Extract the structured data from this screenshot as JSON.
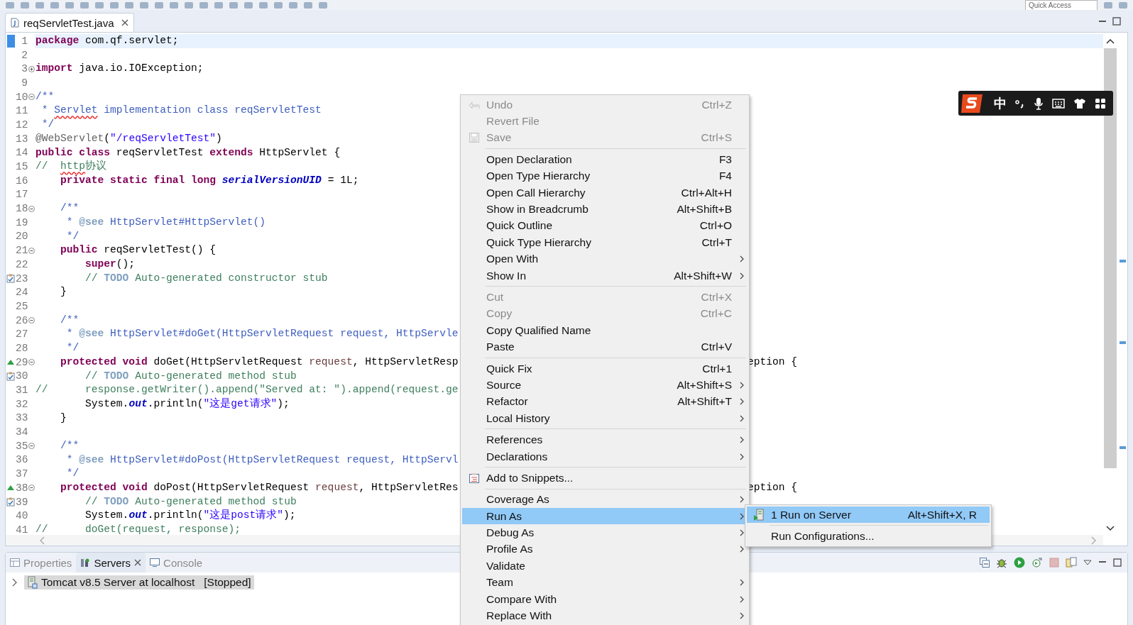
{
  "toolbar": {
    "quick_access": {
      "placeholder": "Quick Access"
    }
  },
  "editor": {
    "tabs": [
      {
        "title": "reqServletTest.java",
        "selected": true
      }
    ],
    "lines": [
      {
        "number": "1",
        "kind": "bookmark",
        "current": true,
        "tokens": [
          {
            "kind": "keyword",
            "text": "package"
          },
          {
            "kind": "plain",
            "text": " com.qf.servlet;"
          }
        ]
      },
      {
        "number": "2",
        "kind": "code",
        "current": false
      },
      {
        "number": "3",
        "kind": "code",
        "current": false,
        "collapsed": true,
        "tokens": [
          {
            "kind": "keyword",
            "text": "import"
          },
          {
            "kind": "plain",
            "text": " java.io.IOException;"
          }
        ]
      },
      {
        "number": "9",
        "kind": "code",
        "current": false
      },
      {
        "number": "10",
        "kind": "code",
        "current": false,
        "collapsed": false,
        "tokens": [
          {
            "kind": "javadoc",
            "text": "/**"
          }
        ]
      },
      {
        "number": "11",
        "kind": "code",
        "current": false,
        "tokens": [
          {
            "kind": "javadoc",
            "text": " * "
          },
          {
            "kind": "misspelled-javadoc",
            "text": "Servlet"
          },
          {
            "kind": "javadoc",
            "text": " implementation class reqServletTest"
          }
        ]
      },
      {
        "number": "12",
        "kind": "code",
        "current": false,
        "tokens": [
          {
            "kind": "javadoc",
            "text": " */"
          }
        ]
      },
      {
        "number": "13",
        "kind": "code",
        "current": false,
        "tokens": [
          {
            "kind": "annotation",
            "text": "@WebServlet"
          },
          {
            "kind": "plain",
            "text": "("
          },
          {
            "kind": "string",
            "text": "\"/reqServletTest\""
          },
          {
            "kind": "plain",
            "text": ")"
          }
        ]
      },
      {
        "number": "14",
        "kind": "code",
        "current": false,
        "tokens": [
          {
            "kind": "keyword",
            "text": "public class"
          },
          {
            "kind": "plain",
            "text": " reqServletTest "
          },
          {
            "kind": "keyword",
            "text": "extends"
          },
          {
            "kind": "plain",
            "text": " HttpServlet {"
          }
        ]
      },
      {
        "number": "15",
        "kind": "code",
        "current": false,
        "tokens": [
          {
            "kind": "comment",
            "text": "//  "
          },
          {
            "kind": "misspelled-comment",
            "text": "http"
          },
          {
            "kind": "comment",
            "text": "协议"
          }
        ]
      },
      {
        "number": "16",
        "kind": "code",
        "current": false,
        "tokens": [
          {
            "kind": "keyword",
            "text": "    private static final long"
          },
          {
            "kind": "static-field",
            "text": " serialVersionUID"
          },
          {
            "kind": "plain",
            "text": " = 1L;"
          }
        ]
      },
      {
        "number": "17",
        "kind": "code",
        "current": false
      },
      {
        "number": "18",
        "kind": "code",
        "current": false,
        "collapsed": false,
        "tokens": [
          {
            "kind": "javadoc",
            "text": "    /**"
          }
        ]
      },
      {
        "number": "19",
        "kind": "code",
        "current": false,
        "tokens": [
          {
            "kind": "javadoc",
            "text": "     * "
          },
          {
            "kind": "tag",
            "text": "@see"
          },
          {
            "kind": "javadoc",
            "text": " HttpServlet#HttpServlet()"
          }
        ]
      },
      {
        "number": "20",
        "kind": "code",
        "current": false,
        "tokens": [
          {
            "kind": "javadoc",
            "text": "     */"
          }
        ]
      },
      {
        "number": "21",
        "kind": "code",
        "current": false,
        "collapsed": false,
        "tokens": [
          {
            "kind": "keyword",
            "text": "    public"
          },
          {
            "kind": "plain",
            "text": " reqServletTest() {"
          }
        ]
      },
      {
        "number": "22",
        "kind": "code",
        "current": false,
        "tokens": [
          {
            "kind": "keyword",
            "text": "        super"
          },
          {
            "kind": "plain",
            "text": "();"
          }
        ]
      },
      {
        "number": "23",
        "kind": "task",
        "current": false,
        "tokens": [
          {
            "kind": "comment",
            "text": "        // "
          },
          {
            "kind": "todo",
            "text": "TODO"
          },
          {
            "kind": "comment",
            "text": " Auto-generated constructor stub"
          }
        ]
      },
      {
        "number": "24",
        "kind": "code",
        "current": false,
        "tokens": [
          {
            "kind": "plain",
            "text": "    }"
          }
        ]
      },
      {
        "number": "25",
        "kind": "code",
        "current": false
      },
      {
        "number": "26",
        "kind": "code",
        "current": false,
        "collapsed": false,
        "tokens": [
          {
            "kind": "javadoc",
            "text": "    /**"
          }
        ]
      },
      {
        "number": "27",
        "kind": "code",
        "current": false,
        "tokens": [
          {
            "kind": "javadoc",
            "text": "     * "
          },
          {
            "kind": "tag",
            "text": "@see"
          },
          {
            "kind": "javadoc",
            "text": " HttpServlet#doGet(HttpServletRequest request, HttpServle"
          }
        ]
      },
      {
        "number": "28",
        "kind": "code",
        "current": false,
        "tokens": [
          {
            "kind": "javadoc",
            "text": "     */"
          }
        ]
      },
      {
        "number": "29",
        "kind": "override",
        "current": false,
        "collapsed": false,
        "tokens": [
          {
            "kind": "keyword",
            "text": "    protected void"
          },
          {
            "kind": "plain",
            "text": " doGet(HttpServletRequest "
          },
          {
            "kind": "param",
            "text": "request"
          },
          {
            "kind": "plain",
            "text": ", HttpServletResp"
          }
        ],
        "tail": "eption {"
      },
      {
        "number": "30",
        "kind": "task",
        "current": false,
        "tokens": [
          {
            "kind": "comment",
            "text": "        // "
          },
          {
            "kind": "todo",
            "text": "TODO"
          },
          {
            "kind": "comment",
            "text": " Auto-generated method stub"
          }
        ]
      },
      {
        "number": "31",
        "kind": "code",
        "current": false,
        "tokens": [
          {
            "kind": "comment",
            "text": "//      response.getWriter().append(\"Served at: \").append(request.ge"
          }
        ]
      },
      {
        "number": "32",
        "kind": "code",
        "current": false,
        "tokens": [
          {
            "kind": "plain",
            "text": "        System."
          },
          {
            "kind": "static-field",
            "text": "out"
          },
          {
            "kind": "plain",
            "text": ".println("
          },
          {
            "kind": "string",
            "text": "\"这是get请求\""
          },
          {
            "kind": "plain",
            "text": ");"
          }
        ]
      },
      {
        "number": "33",
        "kind": "code",
        "current": false,
        "tokens": [
          {
            "kind": "plain",
            "text": "    }"
          }
        ]
      },
      {
        "number": "34",
        "kind": "code",
        "current": false
      },
      {
        "number": "35",
        "kind": "code",
        "current": false,
        "collapsed": false,
        "tokens": [
          {
            "kind": "javadoc",
            "text": "    /**"
          }
        ]
      },
      {
        "number": "36",
        "kind": "code",
        "current": false,
        "tokens": [
          {
            "kind": "javadoc",
            "text": "     * "
          },
          {
            "kind": "tag",
            "text": "@see"
          },
          {
            "kind": "javadoc",
            "text": " HttpServlet#doPost(HttpServletRequest request, HttpServl"
          }
        ]
      },
      {
        "number": "37",
        "kind": "code",
        "current": false,
        "tokens": [
          {
            "kind": "javadoc",
            "text": "     */"
          }
        ]
      },
      {
        "number": "38",
        "kind": "override",
        "current": false,
        "collapsed": false,
        "tokens": [
          {
            "kind": "keyword",
            "text": "    protected void"
          },
          {
            "kind": "plain",
            "text": " doPost(HttpServletRequest "
          },
          {
            "kind": "param",
            "text": "request"
          },
          {
            "kind": "plain",
            "text": ", HttpServletRes"
          }
        ],
        "tail": "eption {"
      },
      {
        "number": "39",
        "kind": "task",
        "current": false,
        "tokens": [
          {
            "kind": "comment",
            "text": "        // "
          },
          {
            "kind": "todo",
            "text": "TODO"
          },
          {
            "kind": "comment",
            "text": " Auto-generated method stub"
          }
        ]
      },
      {
        "number": "40",
        "kind": "code",
        "current": false,
        "tokens": [
          {
            "kind": "plain",
            "text": "        System."
          },
          {
            "kind": "static-field",
            "text": "out"
          },
          {
            "kind": "plain",
            "text": ".println("
          },
          {
            "kind": "string",
            "text": "\"这是post请求\""
          },
          {
            "kind": "plain",
            "text": ");"
          }
        ]
      },
      {
        "number": "41",
        "kind": "code",
        "current": false,
        "tokens": [
          {
            "kind": "comment",
            "text": "//      doGet(request, response);"
          }
        ]
      }
    ]
  },
  "context_menu": {
    "items": [
      {
        "kind": "undo",
        "label": "Undo",
        "shortcut": "Ctrl+Z",
        "disabled": true,
        "submenu": false,
        "selected": false
      },
      {
        "kind": "item",
        "label": "Revert File",
        "disabled": true,
        "submenu": false,
        "selected": false
      },
      {
        "kind": "save",
        "label": "Save",
        "shortcut": "Ctrl+S",
        "disabled": true,
        "submenu": false,
        "selected": false
      },
      {
        "kind": "separator"
      },
      {
        "kind": "item",
        "label": "Open Declaration",
        "shortcut": "F3",
        "disabled": false,
        "submenu": false,
        "selected": false
      },
      {
        "kind": "item",
        "label": "Open Type Hierarchy",
        "shortcut": "F4",
        "disabled": false,
        "submenu": false,
        "selected": false
      },
      {
        "kind": "item",
        "label": "Open Call Hierarchy",
        "shortcut": "Ctrl+Alt+H",
        "disabled": false,
        "submenu": false,
        "selected": false
      },
      {
        "kind": "item",
        "label": "Show in Breadcrumb",
        "shortcut": "Alt+Shift+B",
        "disabled": false,
        "submenu": false,
        "selected": false
      },
      {
        "kind": "item",
        "label": "Quick Outline",
        "shortcut": "Ctrl+O",
        "disabled": false,
        "submenu": false,
        "selected": false
      },
      {
        "kind": "item",
        "label": "Quick Type Hierarchy",
        "shortcut": "Ctrl+T",
        "disabled": false,
        "submenu": false,
        "selected": false
      },
      {
        "kind": "item",
        "label": "Open With",
        "disabled": false,
        "submenu": true,
        "selected": false
      },
      {
        "kind": "item",
        "label": "Show In",
        "shortcut": "Alt+Shift+W",
        "disabled": false,
        "submenu": true,
        "selected": false
      },
      {
        "kind": "separator"
      },
      {
        "kind": "item",
        "label": "Cut",
        "shortcut": "Ctrl+X",
        "disabled": true,
        "submenu": false,
        "selected": false
      },
      {
        "kind": "item",
        "label": "Copy",
        "shortcut": "Ctrl+C",
        "disabled": true,
        "submenu": false,
        "selected": false
      },
      {
        "kind": "item",
        "label": "Copy Qualified Name",
        "disabled": false,
        "submenu": false,
        "selected": false
      },
      {
        "kind": "item",
        "label": "Paste",
        "shortcut": "Ctrl+V",
        "disabled": false,
        "submenu": false,
        "selected": false
      },
      {
        "kind": "separator"
      },
      {
        "kind": "item",
        "label": "Quick Fix",
        "shortcut": "Ctrl+1",
        "disabled": false,
        "submenu": false,
        "selected": false
      },
      {
        "kind": "item",
        "label": "Source",
        "shortcut": "Alt+Shift+S",
        "disabled": false,
        "submenu": true,
        "selected": false
      },
      {
        "kind": "item",
        "label": "Refactor",
        "shortcut": "Alt+Shift+T",
        "disabled": false,
        "submenu": true,
        "selected": false
      },
      {
        "kind": "item",
        "label": "Local History",
        "disabled": false,
        "submenu": true,
        "selected": false
      },
      {
        "kind": "separator"
      },
      {
        "kind": "item",
        "label": "References",
        "disabled": false,
        "submenu": true,
        "selected": false
      },
      {
        "kind": "item",
        "label": "Declarations",
        "disabled": false,
        "submenu": true,
        "selected": false
      },
      {
        "kind": "separator"
      },
      {
        "kind": "snippets",
        "label": "Add to Snippets...",
        "disabled": false,
        "submenu": false,
        "selected": false
      },
      {
        "kind": "separator"
      },
      {
        "kind": "item",
        "label": "Coverage As",
        "disabled": false,
        "submenu": true,
        "selected": false
      },
      {
        "kind": "item",
        "label": "Run As",
        "disabled": false,
        "submenu": true,
        "selected": true
      },
      {
        "kind": "item",
        "label": "Debug As",
        "disabled": false,
        "submenu": true,
        "selected": false
      },
      {
        "kind": "item",
        "label": "Profile As",
        "disabled": false,
        "submenu": true,
        "selected": false
      },
      {
        "kind": "item",
        "label": "Validate",
        "disabled": false,
        "submenu": false,
        "selected": false
      },
      {
        "kind": "item",
        "label": "Team",
        "disabled": false,
        "submenu": true,
        "selected": false
      },
      {
        "kind": "item",
        "label": "Compare With",
        "disabled": false,
        "submenu": true,
        "selected": false
      },
      {
        "kind": "item",
        "label": "Replace With",
        "disabled": false,
        "submenu": true,
        "selected": false
      }
    ]
  },
  "submenu": {
    "items": [
      {
        "kind": "server",
        "label": "1 Run on Server",
        "shortcut": "Alt+Shift+X, R",
        "selected": true
      },
      {
        "kind": "separator"
      },
      {
        "kind": "item",
        "label": "Run Configurations...",
        "selected": false
      }
    ]
  },
  "bottom_panel": {
    "tabs": [
      {
        "kind": "properties",
        "label": "Properties",
        "selected": false
      },
      {
        "kind": "servers",
        "label": "Servers",
        "selected": true
      },
      {
        "kind": "console",
        "label": "Console",
        "selected": false
      }
    ],
    "tree": [
      {
        "name": "Tomcat v8.5 Server at localhost",
        "status": "[Stopped]",
        "selected": true,
        "expanded": false
      }
    ]
  },
  "ime_bar": {
    "mode": "中"
  }
}
